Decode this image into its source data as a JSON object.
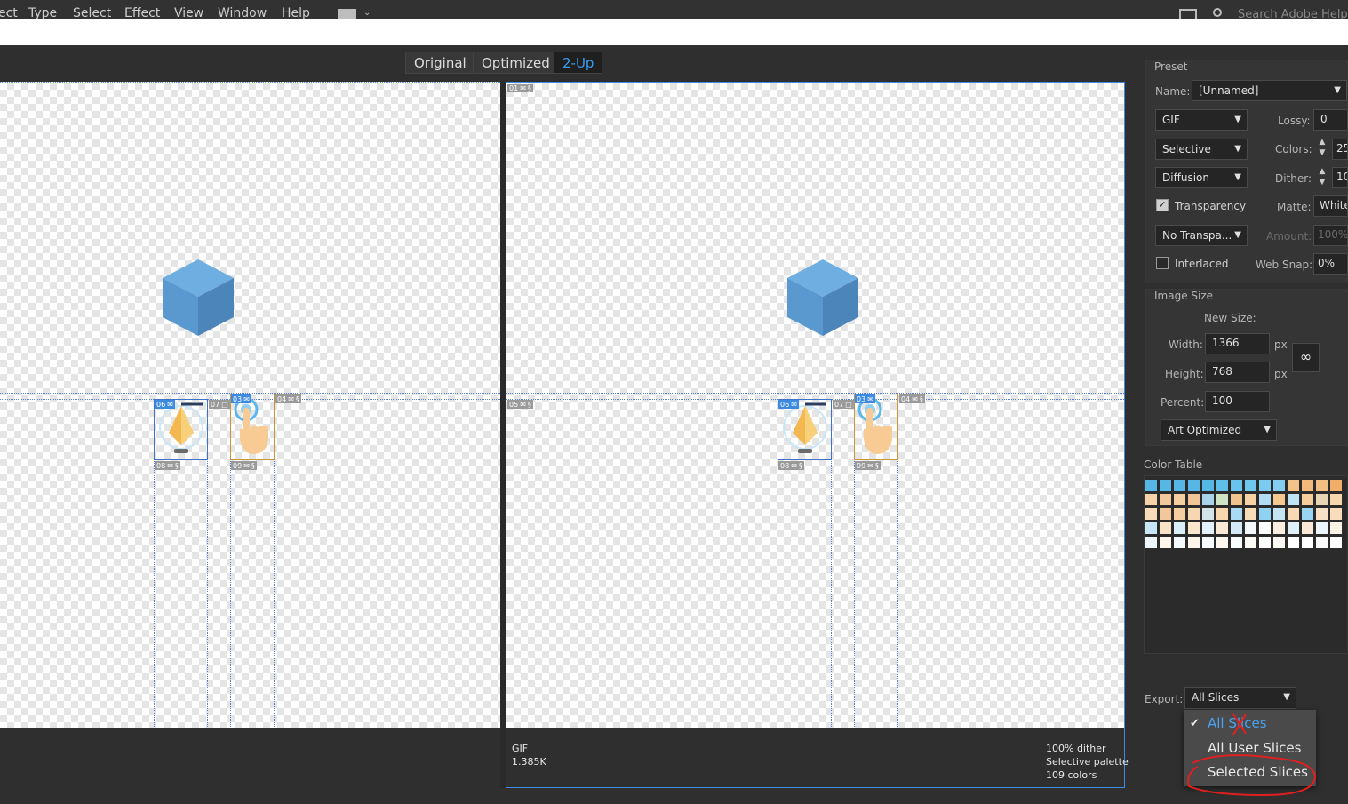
{
  "menubar": {
    "items": [
      "ect",
      "Type",
      "Select",
      "Effect",
      "View",
      "Window",
      "Help"
    ],
    "search_placeholder": "Search Adobe Help"
  },
  "view_tabs": [
    {
      "label": "Original",
      "active": false
    },
    {
      "label": "Optimized",
      "active": false
    },
    {
      "label": "2-Up",
      "active": true
    }
  ],
  "slice_numbers": [
    "01",
    "03",
    "04",
    "05",
    "06",
    "07",
    "08",
    "09"
  ],
  "left_info": {
    "line1": "",
    "line2": ""
  },
  "right_info": {
    "format": "GIF",
    "size": "1.385K",
    "dither": "100% dither",
    "palette": "Selective palette",
    "colors": "109 colors"
  },
  "preset": {
    "section_label": "Preset",
    "name_label": "Name:",
    "name_value": "[Unnamed]",
    "format": "GIF",
    "lossy_label": "Lossy:",
    "lossy_value": "0",
    "reduction": "Selective",
    "colors_label": "Colors:",
    "colors_value": "25",
    "dither_algo": "Diffusion",
    "dither_label": "Dither:",
    "dither_value": "10",
    "transparency_label": "Transparency",
    "transparency_checked": true,
    "matte_label": "Matte:",
    "matte_value": "White",
    "transparency_dither": "No Transpa...",
    "amount_label": "Amount:",
    "amount_value": "100%",
    "interlaced_label": "Interlaced",
    "interlaced_checked": false,
    "websnap_label": "Web Snap:",
    "websnap_value": "0%"
  },
  "image_size": {
    "section_label": "Image Size",
    "new_size_label": "New Size:",
    "width_label": "Width:",
    "width_value": "1366",
    "height_label": "Height:",
    "height_value": "768",
    "unit": "px",
    "percent_label": "Percent:",
    "percent_value": "100",
    "quality": "Art Optimized"
  },
  "color_table": {
    "label": "Color Table",
    "swatches": [
      "#56b7e6",
      "#56b7e6",
      "#56b7e6",
      "#56b7e6",
      "#56b7e6",
      "#5ec0ea",
      "#68c4ec",
      "#6fc7ee",
      "#7bcaf0",
      "#84cef0",
      "#f4c38a",
      "#f2b97a",
      "#f3be84",
      "#f0ad68",
      "#f7d2a8",
      "#f3c79c",
      "#f5cfa0",
      "#f1c597",
      "#a9d4ea",
      "#cfe3c7",
      "#f2c48d",
      "#f6d3a5",
      "#b2dcf2",
      "#f4c88f",
      "#bfe2f4",
      "#f6cd9d",
      "#e8d6b5",
      "#f5d6ad",
      "#f8dcb9",
      "#f3c79c",
      "#f5cfa0",
      "#f7d7b1",
      "#d2e5e8",
      "#f7d7ad",
      "#a9dbf5",
      "#f8ddb9",
      "#8fd1f3",
      "#c4e4f2",
      "#f7d9b5",
      "#9ad5f4",
      "#f9e1c5",
      "#f8dcbc",
      "#c9e6f7",
      "#f9e3c7",
      "#d9eef9",
      "#fae6cd",
      "#e3f2fb",
      "#fbe9d3",
      "#d4ebf7",
      "#f3f8fb",
      "#ffffff",
      "#fcefdf",
      "#e0f1fa",
      "#fbead6",
      "#ecf6fc",
      "#fdf2e6",
      "#eef7fc",
      "#fef7ee",
      "#f4fafd",
      "#fdf4ea",
      "#f7fbfe",
      "#fef8f1",
      "#fafdfe",
      "#fffbf6",
      "#ffffff",
      "#fcf9f4",
      "#ffffff",
      "#ffffff",
      "#fafafa",
      "#ffffff"
    ]
  },
  "export": {
    "label": "Export:",
    "value": "All Slices",
    "options": [
      "All Slices",
      "All User Slices",
      "Selected Slices"
    ]
  }
}
